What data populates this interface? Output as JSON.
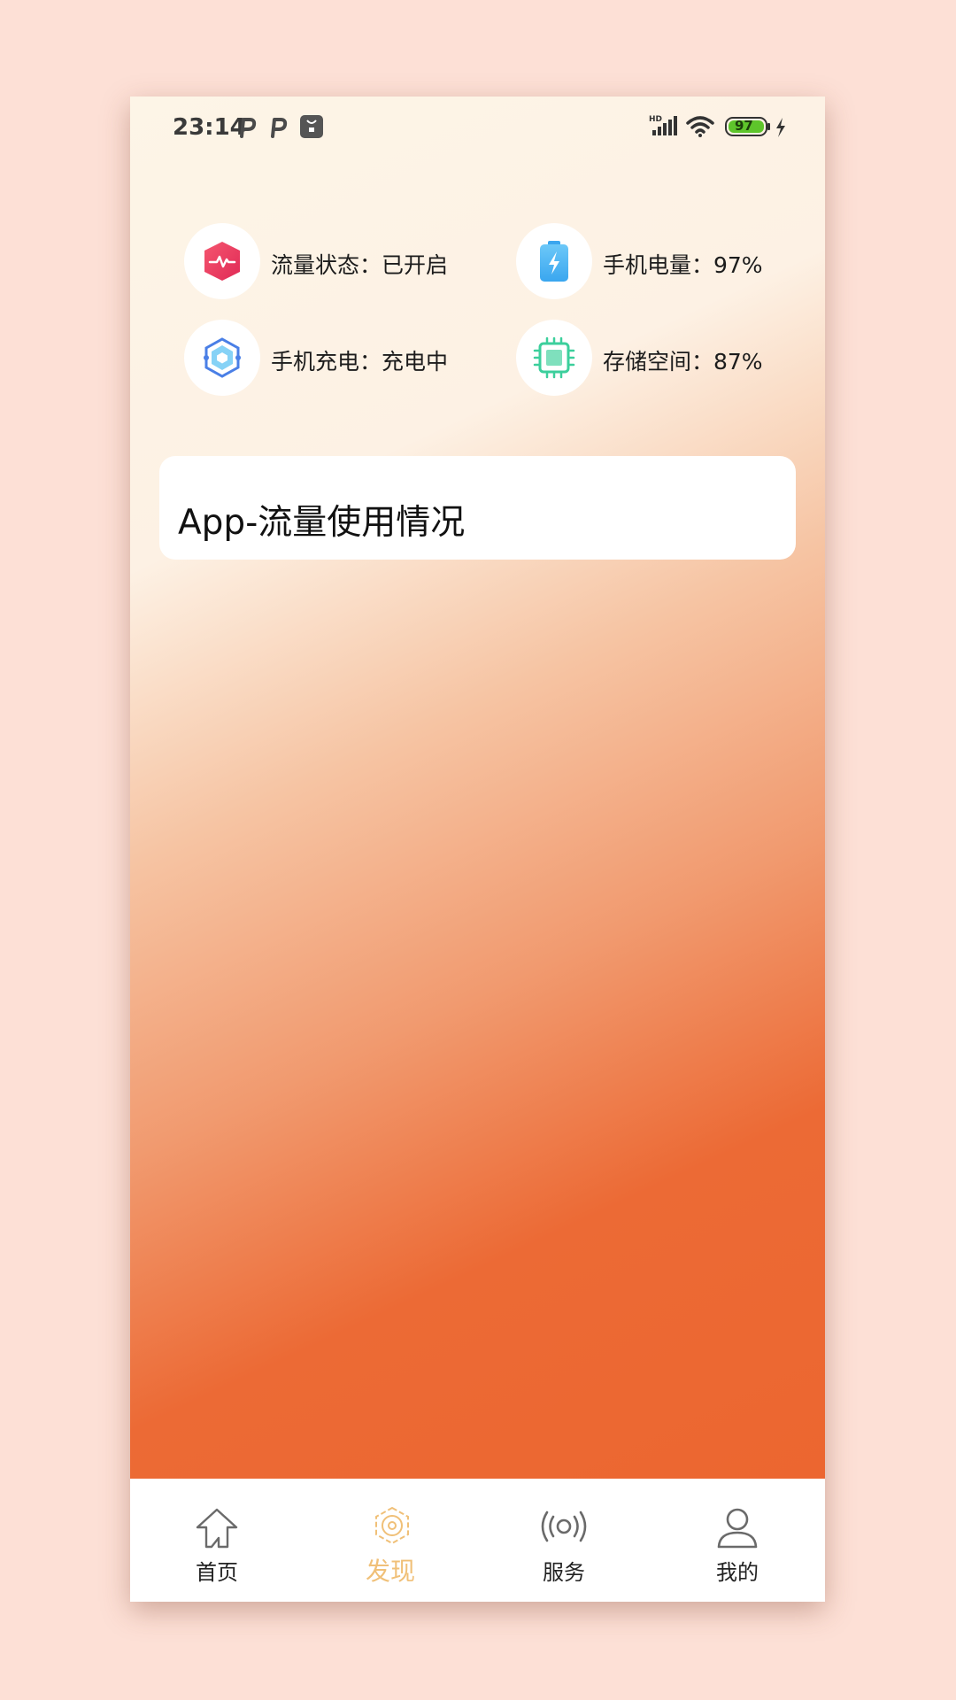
{
  "status_bar": {
    "time": "23:14",
    "left_icons": [
      "parking-app-icon",
      "parking-app-icon",
      "mi-store-icon"
    ],
    "right_icons": [
      "hd-signal-icon",
      "wifi-icon",
      "battery-icon",
      "charging-bolt-icon"
    ],
    "battery_level": "97"
  },
  "metrics": [
    {
      "icon": "traffic-pulse-icon",
      "label": "流量状态：已开启",
      "icon_color": "#e8395a"
    },
    {
      "icon": "battery-charge-icon",
      "label": "手机电量：97%",
      "icon_color": "#4fb4f3"
    },
    {
      "icon": "hexagon-charge-icon",
      "label": "手机充电：充电中",
      "icon_color": "#4a7fe6"
    },
    {
      "icon": "chip-storage-icon",
      "label": "存储空间：87%",
      "icon_color": "#3ccf9c"
    }
  ],
  "usage_card": {
    "title": "App-流量使用情况"
  },
  "bottom_nav": {
    "items": [
      {
        "label": "首页",
        "icon": "home-icon",
        "active": false
      },
      {
        "label": "发现",
        "icon": "discover-icon",
        "active": true
      },
      {
        "label": "服务",
        "icon": "broadcast-icon",
        "active": false
      },
      {
        "label": "我的",
        "icon": "user-icon",
        "active": false
      }
    ],
    "active_color": "#f0c078"
  },
  "colors": {
    "gradient_start": "#fdf5e7",
    "gradient_end": "#ec652e",
    "page_background": "#fde0d6"
  }
}
